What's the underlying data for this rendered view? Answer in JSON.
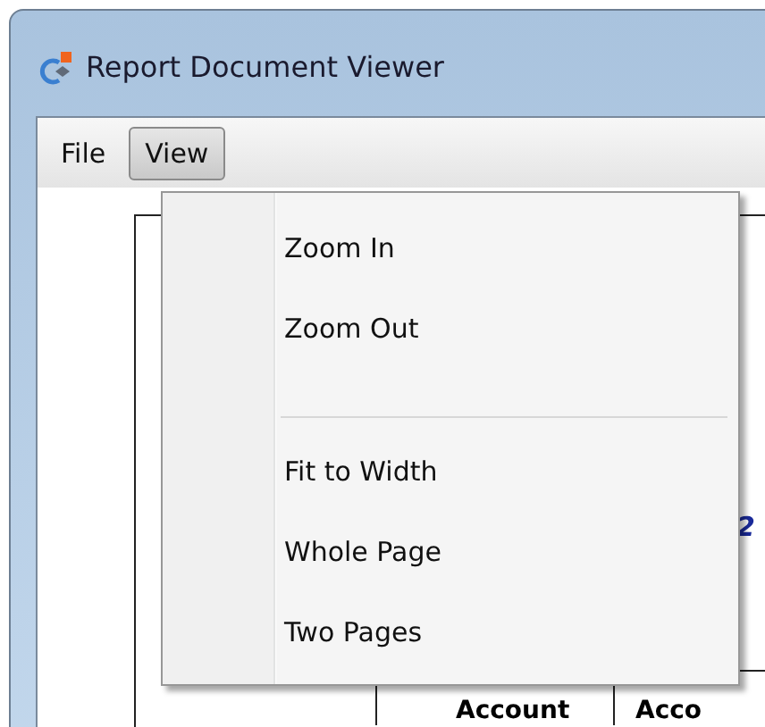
{
  "window": {
    "title": "Report Document Viewer"
  },
  "menu_bar": [
    {
      "label": "File",
      "selected": false
    },
    {
      "label": "View",
      "selected": true
    }
  ],
  "dropdown": {
    "items": [
      {
        "kind": "item",
        "label": "Zoom In"
      },
      {
        "kind": "item",
        "label": "Zoom Out"
      },
      {
        "kind": "separator"
      },
      {
        "kind": "item",
        "label": "Fit to Width"
      },
      {
        "kind": "item",
        "label": "Whole Page"
      },
      {
        "kind": "item",
        "label": "Two Pages"
      }
    ]
  },
  "report": {
    "heading_fragment": "2",
    "columns": [
      "Account",
      "Acco"
    ]
  }
}
